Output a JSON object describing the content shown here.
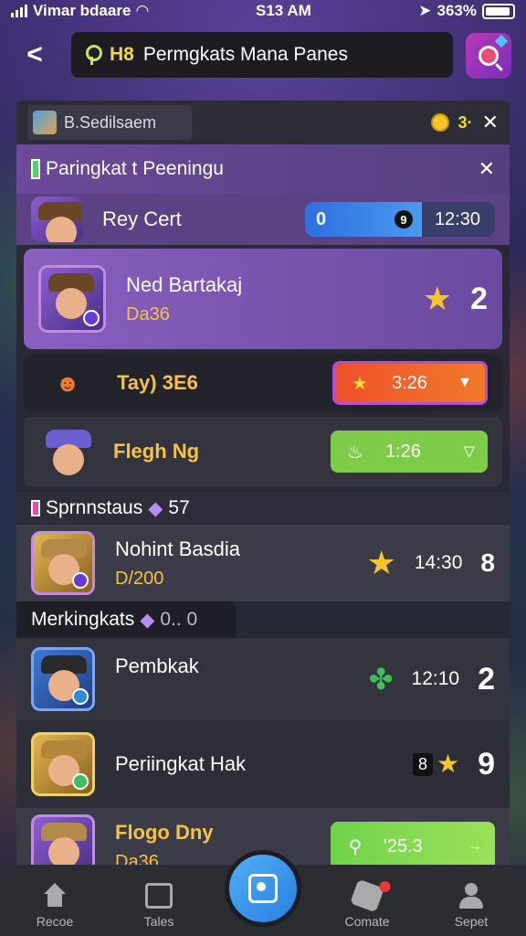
{
  "status_bar": {
    "carrier": "Vimar bdaare",
    "time": "S13 AM",
    "battery": "363%"
  },
  "header": {
    "search_prefix": "H8",
    "search_text": "Permgkats Mana Panes"
  },
  "panel": {
    "tab_label": "B.Sedilsaem",
    "coins": "3·"
  },
  "section1": {
    "title": "Paringkat t Peeningu"
  },
  "rows": [
    {
      "name": "Rey Cert",
      "bar_value": "0",
      "bar_knob": "9",
      "bar_time": "12:30"
    },
    {
      "name": "Ned Bartakaj",
      "sub": "Da36",
      "rank": "2"
    },
    {
      "name": "Tay) 3E6",
      "time": "3:26"
    },
    {
      "name": "Flegh Ng",
      "time": "1:26"
    }
  ],
  "section2": {
    "title": "Sprnnstaus",
    "count": "57"
  },
  "row5": {
    "name": "Nohint Basdia",
    "sub": "D/200",
    "time": "14:30",
    "rank": "8"
  },
  "section3": {
    "title": "Merkingkats",
    "count": "0.. 0"
  },
  "rows2": [
    {
      "name": "Pembkak",
      "time": "12:10",
      "rank": "2"
    },
    {
      "name": "Periingkat Hak",
      "badge": "8",
      "rank": "9"
    },
    {
      "name": "Flogo Dny",
      "sub": "Da36",
      "time": "'25.3"
    }
  ],
  "nav": {
    "items": [
      "Recoe",
      "Tales",
      "Comate",
      "Sepet"
    ]
  },
  "colors": {
    "accent_violet": "#6b4a9a",
    "accent_gold": "#f5c244",
    "accent_orange": "#f0502a",
    "accent_green": "#7ecb4a",
    "accent_blue": "#2f6fe0"
  }
}
